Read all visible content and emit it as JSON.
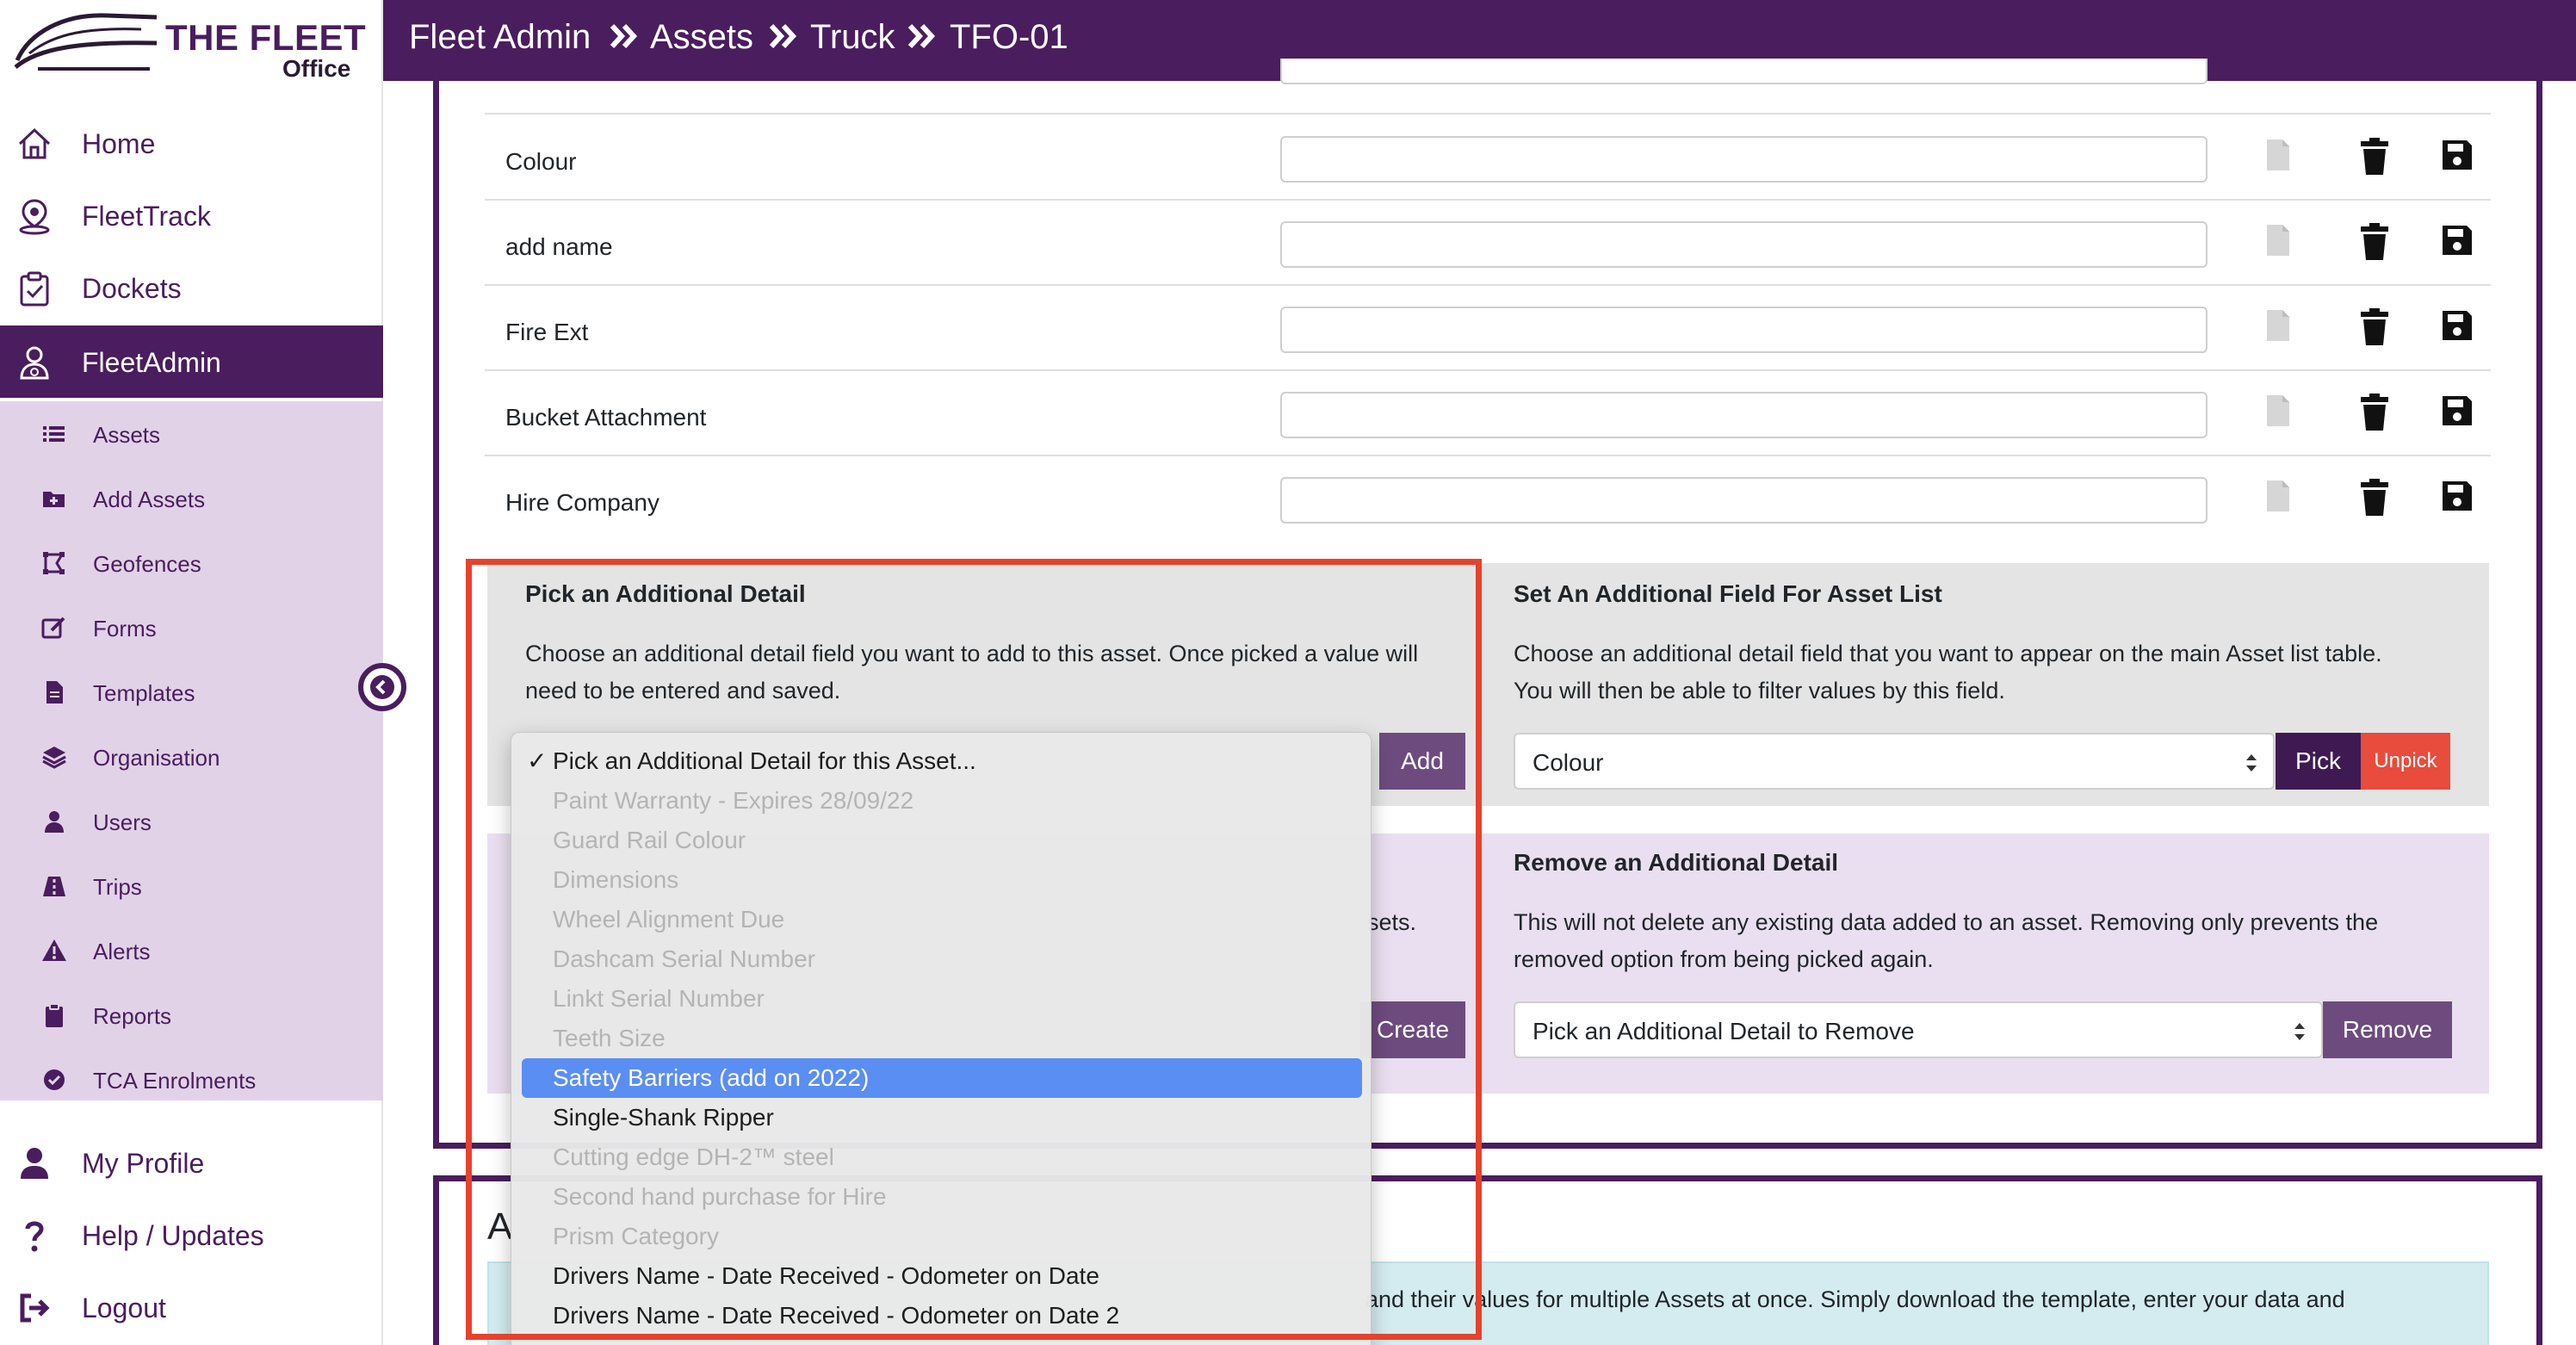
{
  "brand": {
    "title": "THE FLEET",
    "subtitle": "Office",
    "color": "#4a1d5e"
  },
  "sidebar": {
    "main_items": [
      {
        "label": "Home",
        "icon": "home-icon"
      },
      {
        "label": "FleetTrack",
        "icon": "map-pin-icon"
      },
      {
        "label": "Dockets",
        "icon": "clipboard-check-icon"
      },
      {
        "label": "FleetAdmin",
        "icon": "admin-user-icon",
        "active": true
      }
    ],
    "sub_items": [
      {
        "label": "Assets",
        "icon": "list-icon"
      },
      {
        "label": "Add Assets",
        "icon": "folder-plus-icon"
      },
      {
        "label": "Geofences",
        "icon": "geofence-icon"
      },
      {
        "label": "Forms",
        "icon": "edit-icon"
      },
      {
        "label": "Templates",
        "icon": "file-icon"
      },
      {
        "label": "Organisation",
        "icon": "layers-icon"
      },
      {
        "label": "Users",
        "icon": "user-icon"
      },
      {
        "label": "Trips",
        "icon": "road-icon"
      },
      {
        "label": "Alerts",
        "icon": "warning-icon"
      },
      {
        "label": "Reports",
        "icon": "clipboard-icon"
      },
      {
        "label": "TCA Enrolments",
        "icon": "check-circle-icon"
      }
    ],
    "bottom_items": [
      {
        "label": "My Profile",
        "icon": "user-icon"
      },
      {
        "label": "Help / Updates",
        "icon": "question-icon"
      },
      {
        "label": "Logout",
        "icon": "logout-icon"
      }
    ]
  },
  "header": {
    "breadcrumb": [
      "Fleet Admin",
      "Assets",
      "Truck",
      "TFO-01"
    ]
  },
  "detail_rows": [
    {
      "label": "Colour",
      "value": ""
    },
    {
      "label": "add name",
      "value": ""
    },
    {
      "label": "Fire Ext",
      "value": ""
    },
    {
      "label": "Bucket Attachment",
      "value": ""
    },
    {
      "label": "Hire Company",
      "value": ""
    }
  ],
  "pick_panel": {
    "title": "Pick an Additional Detail",
    "desc_line1": "Choose an additional detail field you want to add to this asset. Once picked a value will",
    "desc_line2": "need to be entered and saved.",
    "add_label": "Add"
  },
  "set_field_panel": {
    "title": "Set An Additional Field For Asset List",
    "desc_line1": "Choose an additional detail field that you want to appear on the main Asset list table.",
    "desc_line2": "You will then be able to filter values by this field.",
    "select_value": "Colour",
    "pick_label": "Pick",
    "unpick_label": "Unpick"
  },
  "create_panel": {
    "desc_tail": "sets.",
    "create_label": "Create"
  },
  "remove_panel": {
    "title": "Remove an Additional Detail",
    "desc_line1": "This will not delete any existing data added to an asset. Removing only prevents the",
    "desc_line2": "removed option from being picked again.",
    "select_value": "Pick an Additional Detail to Remove",
    "remove_label": "Remove"
  },
  "bulk_section": {
    "heading_letter": "A",
    "info_text": "and their values for multiple Assets at once. Simply download the template, enter your data and"
  },
  "dropdown": {
    "selected": "Pick an Additional Detail for this Asset...",
    "options": [
      {
        "label": "Paint Warranty - Expires 28/09/22",
        "enabled": false
      },
      {
        "label": "Guard Rail Colour",
        "enabled": false
      },
      {
        "label": "Dimensions",
        "enabled": false
      },
      {
        "label": "Wheel Alignment Due",
        "enabled": false
      },
      {
        "label": "Dashcam Serial Number",
        "enabled": false
      },
      {
        "label": "Linkt Serial Number",
        "enabled": false
      },
      {
        "label": "Teeth Size",
        "enabled": false
      },
      {
        "label": "Safety Barriers (add on 2022)",
        "enabled": true,
        "highlighted": true
      },
      {
        "label": "Single-Shank Ripper",
        "enabled": true
      },
      {
        "label": "Cutting edge DH-2™ steel",
        "enabled": false
      },
      {
        "label": "Second hand purchase for Hire",
        "enabled": false
      },
      {
        "label": "Prism Category",
        "enabled": false
      },
      {
        "label": "Drivers Name - Date Received - Odometer on Date",
        "enabled": true
      },
      {
        "label": "Drivers Name - Date Received - Odometer on Date 2",
        "enabled": true
      }
    ]
  },
  "colors": {
    "primary": "#4a1d5e",
    "subnav_bg": "#e2d2e8",
    "highlight": "#5b8ef2",
    "annotation_red": "#e6422c",
    "unpick_red": "#e74c3c"
  }
}
